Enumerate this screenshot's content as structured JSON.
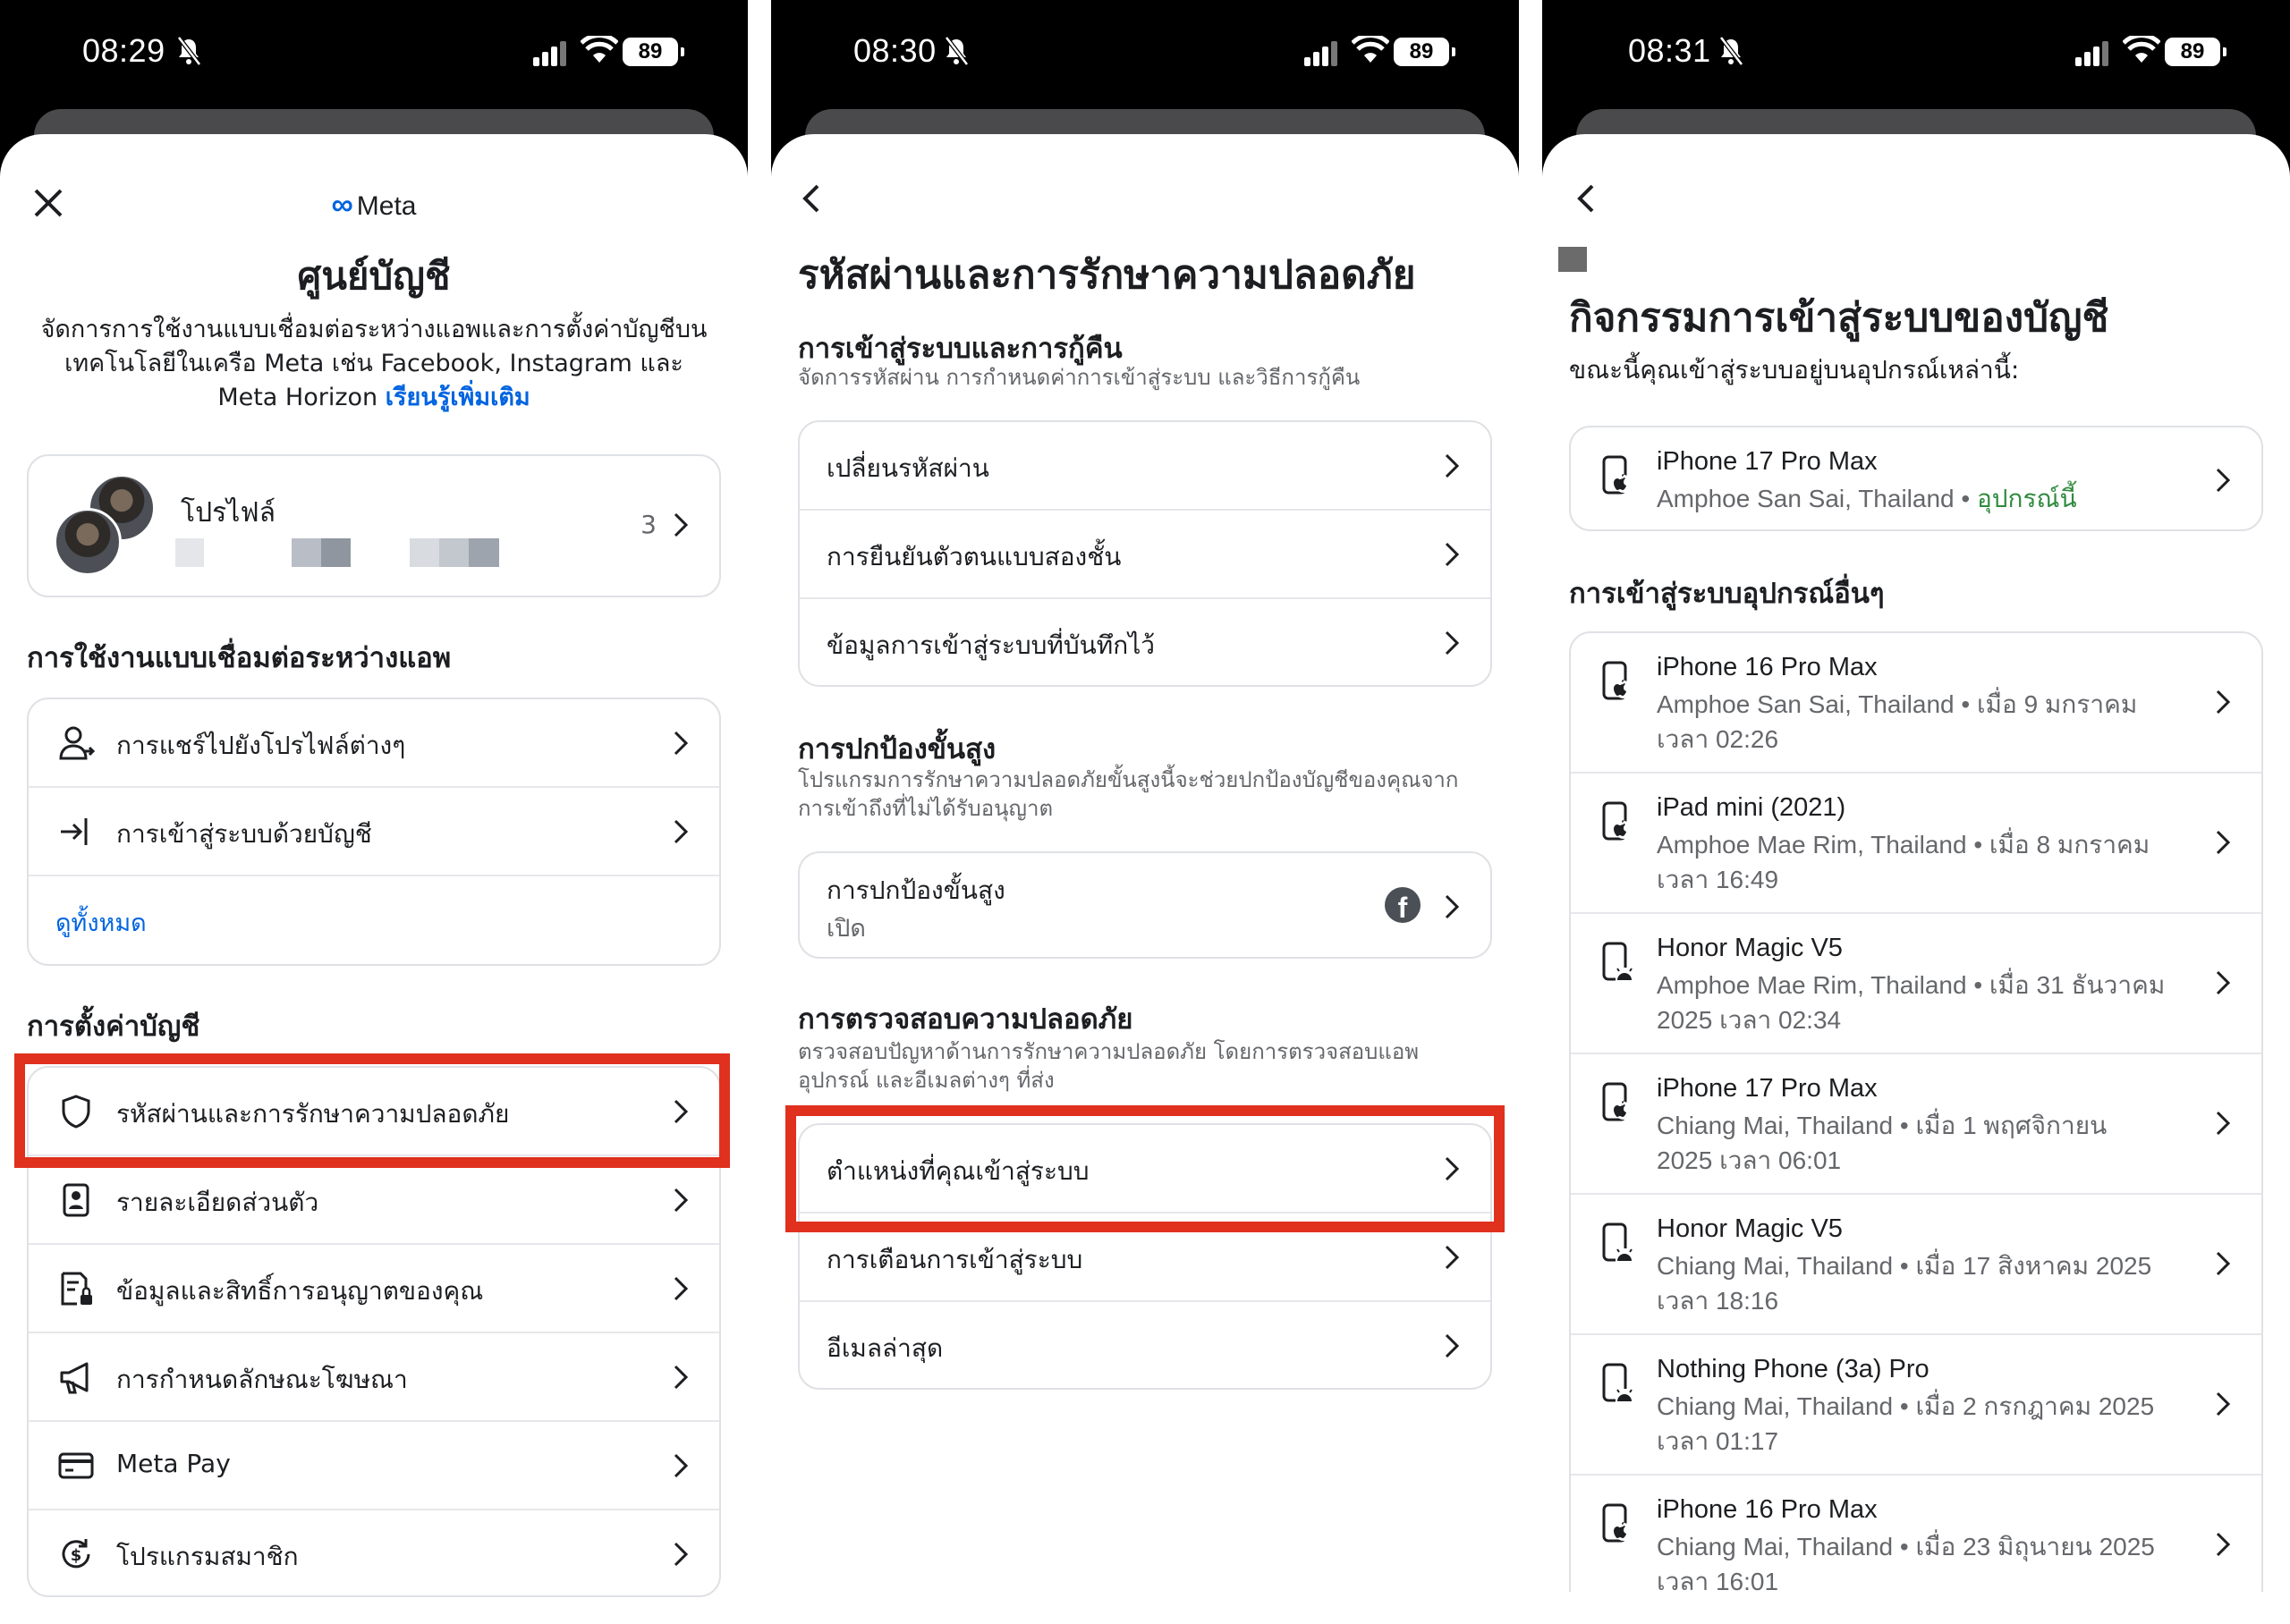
{
  "status_bars": [
    {
      "time": "08:29",
      "battery": "89"
    },
    {
      "time": "08:30",
      "battery": "89"
    },
    {
      "time": "08:31",
      "battery": "89"
    }
  ],
  "panel1": {
    "brand": "Meta",
    "title": "ศูนย์บัญชี",
    "description_line1": "จัดการการใช้งานแบบเชื่อมต่อระหว่างแอพและการตั้งค่าบัญชีบน",
    "description_line2": "เทคโนโลยีในเครือ Meta เช่น Facebook, Instagram และ",
    "description_line3": "Meta Horizon",
    "learn_more": "เรียนรู้เพิ่มเติม",
    "profiles_label": "โปรไฟล์",
    "profiles_count": "3",
    "connected_title": "การใช้งานแบบเชื่อมต่อระหว่างแอพ",
    "connected_items": [
      {
        "label": "การแชร์ไปยังโปรไฟล์ต่างๆ",
        "icon": "profile-share-icon"
      },
      {
        "label": "การเข้าสู่ระบบด้วยบัญชี",
        "icon": "login-arrow-icon"
      }
    ],
    "see_all": "ดูทั้งหมด",
    "settings_title": "การตั้งค่าบัญชี",
    "settings_items": [
      {
        "label": "รหัสผ่านและการรักษาความปลอดภัย",
        "icon": "shield-icon"
      },
      {
        "label": "รายละเอียดส่วนตัว",
        "icon": "id-card-icon"
      },
      {
        "label": "ข้อมูลและสิทธิ์การอนุญาตของคุณ",
        "icon": "document-lock-icon"
      },
      {
        "label": "การกำหนดลักษณะโฆษณา",
        "icon": "megaphone-icon"
      },
      {
        "label": "Meta Pay",
        "icon": "card-icon"
      },
      {
        "label": "โปรแกรมสมาชิก",
        "icon": "dollar-cycle-icon"
      }
    ]
  },
  "panel2": {
    "title": "รหัสผ่านและการรักษาความปลอดภัย",
    "login_section_title": "การเข้าสู่ระบบและการกู้คืน",
    "login_section_sub": "จัดการรหัสผ่าน การกำหนดค่าการเข้าสู่ระบบ และวิธีการกู้คืน",
    "login_items": [
      "เปลี่ยนรหัสผ่าน",
      "การยืนยันตัวตนแบบสองชั้น",
      "ข้อมูลการเข้าสู่ระบบที่บันทึกไว้"
    ],
    "adv_section_title": "การปกป้องขั้นสูง",
    "adv_section_sub_line1": "โปรแกรมการรักษาความปลอดภัยขั้นสูงนี้จะช่วยปกป้องบัญชีของคุณจาก",
    "adv_section_sub_line2": "การเข้าถึงที่ไม่ได้รับอนุญาต",
    "adv_item_label": "การปกป้องขั้นสูง",
    "adv_item_status": "เปิด",
    "check_section_title": "การตรวจสอบความปลอดภัย",
    "check_section_sub_line1": "ตรวจสอบปัญหาด้านการรักษาความปลอดภัย โดยการตรวจสอบแอพ",
    "check_section_sub_line2": "อุปกรณ์ และอีเมลต่างๆ ที่ส่ง",
    "check_items": [
      "ตำแหน่งที่คุณเข้าสู่ระบบ",
      "การเตือนการเข้าสู่ระบบ",
      "อีเมลล่าสุด"
    ]
  },
  "panel3": {
    "title": "กิจกรรมการเข้าสู่ระบบของบัญชี",
    "subtitle": "ขณะนี้คุณเข้าสู่ระบบอยู่บนอุปกรณ์เหล่านี้:",
    "current_device": {
      "name": "iPhone 17 Pro Max",
      "location": "Amphoe San Sai, Thailand • ",
      "tag": "อุปกรณ์นี้",
      "icon": "apple-phone-icon"
    },
    "other_title": "การเข้าสู่ระบบอุปกรณ์อื่นๆ",
    "other_devices": [
      {
        "name": "iPhone 16 Pro Max",
        "line1": "Amphoe San Sai, Thailand • เมื่อ 9 มกราคม",
        "line2": "เวลา 02:26",
        "icon": "apple-phone-icon"
      },
      {
        "name": "iPad mini (2021)",
        "line1": "Amphoe Mae Rim, Thailand • เมื่อ 8 มกราคม",
        "line2": "เวลา 16:49",
        "icon": "apple-phone-icon"
      },
      {
        "name": "Honor Magic V5",
        "line1": "Amphoe Mae Rim, Thailand • เมื่อ 31 ธันวาคม",
        "line2": "2025 เวลา 02:34",
        "icon": "android-phone-icon"
      },
      {
        "name": "iPhone 17 Pro Max",
        "line1": "Chiang Mai, Thailand • เมื่อ 1 พฤศจิกายน",
        "line2": "2025 เวลา 06:01",
        "icon": "apple-phone-icon"
      },
      {
        "name": "Honor Magic V5",
        "line1": "Chiang Mai, Thailand • เมื่อ 17 สิงหาคม 2025",
        "line2": "เวลา 18:16",
        "icon": "android-phone-icon"
      },
      {
        "name": "Nothing Phone (3a) Pro",
        "line1": "Chiang Mai, Thailand • เมื่อ 2 กรกฎาคม 2025",
        "line2": "เวลา 01:17",
        "icon": "android-phone-icon"
      },
      {
        "name": "iPhone 16 Pro Max",
        "line1": "Chiang Mai, Thailand • เมื่อ 23 มิถุนายน 2025",
        "line2": "เวลา 16:01",
        "icon": "apple-phone-icon"
      }
    ]
  },
  "colors": {
    "accent": "#0064e0",
    "highlight": "#e0301e",
    "this_device": "#2f8a3e"
  }
}
